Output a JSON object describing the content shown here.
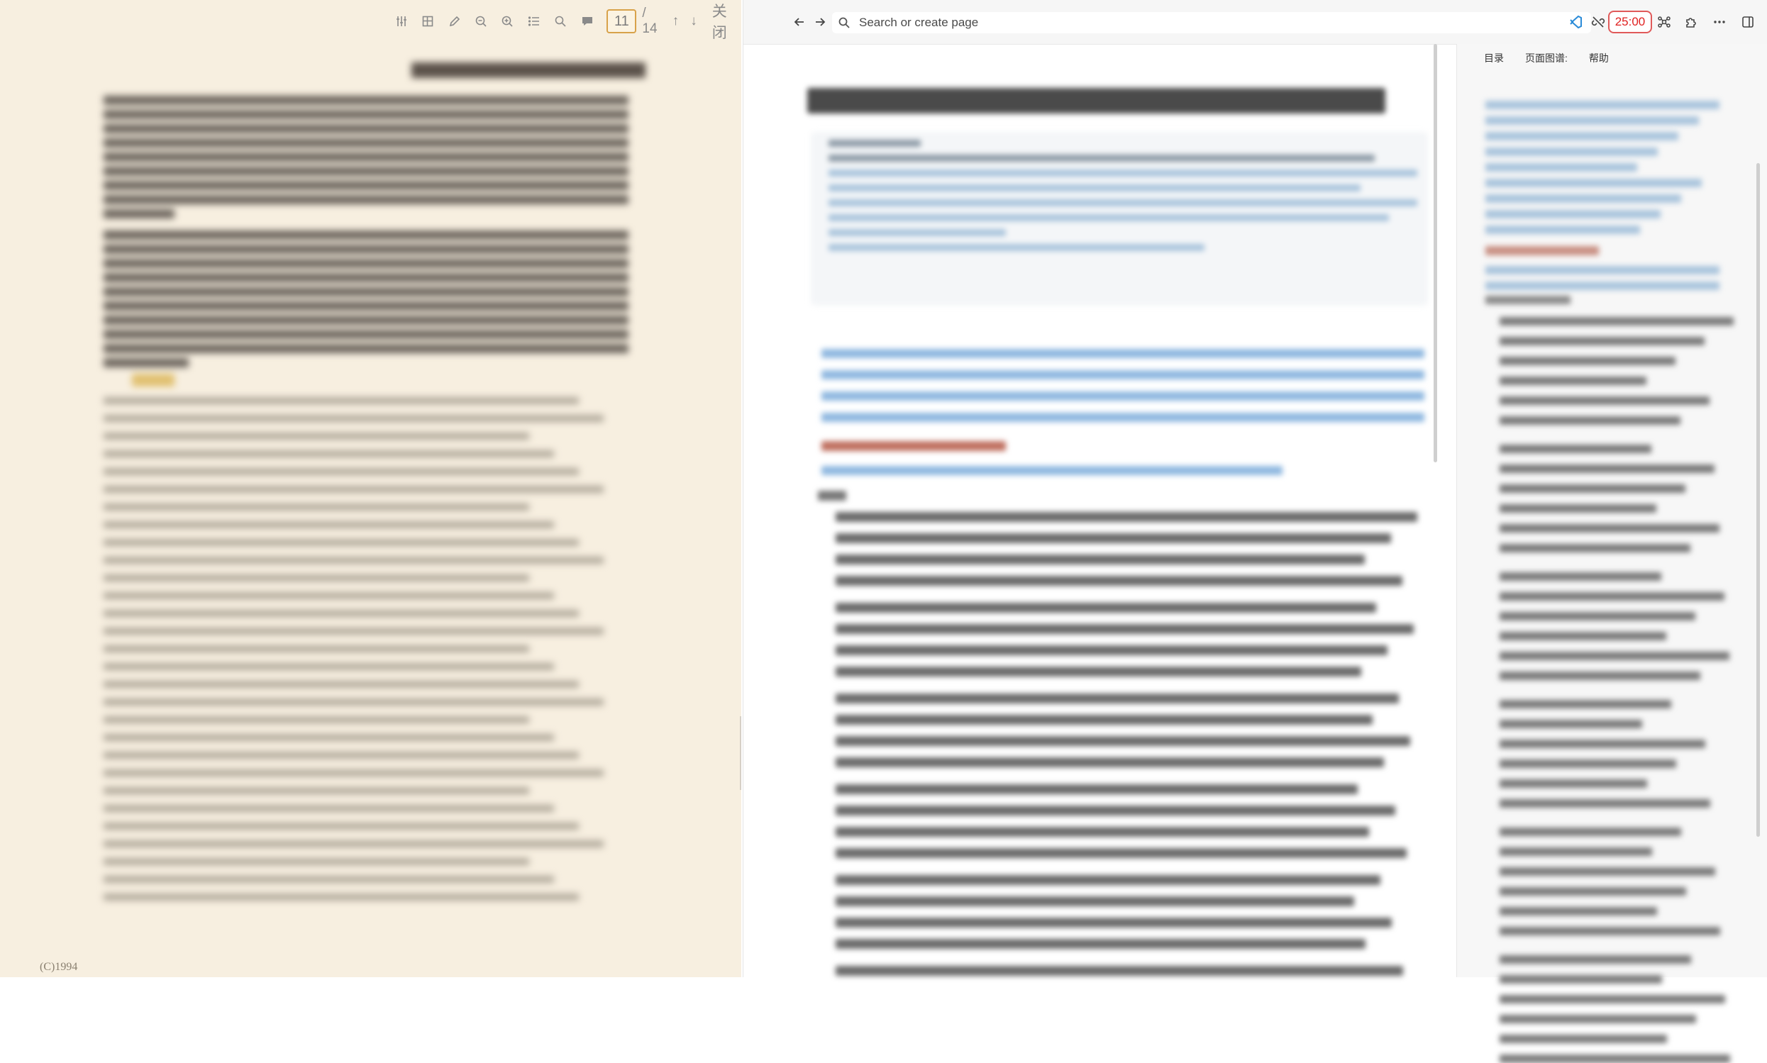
{
  "pdf_viewer": {
    "toolbar": {
      "tools": [
        {
          "icon": "sliders-icon",
          "name": "settings"
        },
        {
          "icon": "image-icon",
          "name": "area-select"
        },
        {
          "icon": "pencil-icon",
          "name": "annotate"
        },
        {
          "icon": "zoom-out-icon",
          "name": "zoom-out"
        },
        {
          "icon": "zoom-in-icon",
          "name": "zoom-in"
        },
        {
          "icon": "list-icon",
          "name": "outline"
        },
        {
          "icon": "search-icon",
          "name": "search"
        },
        {
          "icon": "comment-icon",
          "name": "highlights"
        }
      ],
      "current_page": "11",
      "total_pages": "/ 14",
      "prev_label": "↑",
      "next_label": "↓",
      "close_label": "关闭"
    },
    "footer_text": "(C)1994"
  },
  "header": {
    "back_icon": "arrow-left-icon",
    "forward_icon": "arrow-right-icon",
    "search_placeholder": "Search or create page",
    "timer": "25:00",
    "timer_color": "#e02020",
    "icons": [
      "vscode-icon",
      "link-off-icon",
      "graph-icon",
      "puzzle-icon",
      "more-icon",
      "sidebar-toggle-icon"
    ]
  },
  "sidebar": {
    "tabs": [
      "目录",
      "页面图谱:",
      "帮助"
    ]
  },
  "colors": {
    "pdf_background": "#f7efe0",
    "link_blue": "#7eb0e0",
    "accent_timer": "#e05a5a"
  }
}
